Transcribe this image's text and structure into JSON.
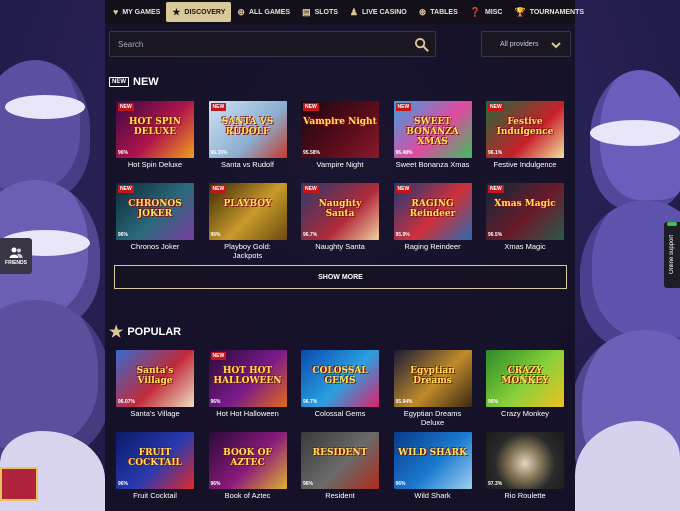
{
  "nav": {
    "items": [
      {
        "label": "MY GAMES",
        "icon": "heart-icon",
        "glyph": "♥",
        "active": false
      },
      {
        "label": "DISCOVERY",
        "icon": "star-icon",
        "glyph": "★",
        "active": true
      },
      {
        "label": "ALL GAMES",
        "icon": "globe-icon",
        "glyph": "⊕",
        "active": false
      },
      {
        "label": "SLOTS",
        "icon": "slots-icon",
        "glyph": "▤",
        "active": false
      },
      {
        "label": "LIVE CASINO",
        "icon": "dealer-icon",
        "glyph": "♟",
        "active": false
      },
      {
        "label": "TABLES",
        "icon": "chip-icon",
        "glyph": "⊛",
        "active": false
      },
      {
        "label": "MISC",
        "icon": "misc-icon",
        "glyph": "❓",
        "active": false
      },
      {
        "label": "TOURNAMENTS",
        "icon": "trophy-icon",
        "glyph": "🏆",
        "active": false
      }
    ]
  },
  "search": {
    "placeholder": "Search"
  },
  "providers": {
    "label": "All providers"
  },
  "sections": {
    "new": {
      "badge": "NEW",
      "title": "NEW",
      "games": [
        {
          "title": "Hot Spin Deluxe",
          "art": "HOT SPIN DELUXE",
          "rtp": "96%",
          "new": true,
          "bg": "linear-gradient(135deg,#3a0a45,#b0144a 55%,#f0a020)"
        },
        {
          "title": "Santa vs Rudolf",
          "art": "SANTA VS RUDOLF",
          "rtp": "96.35%",
          "new": true,
          "bg": "linear-gradient(135deg,#cfe3f5,#8aaed0 60%,#c43a2a)"
        },
        {
          "title": "Vampire Night",
          "art": "Vampire Night",
          "rtp": "95.58%",
          "new": true,
          "bg": "linear-gradient(135deg,#1a0810,#5a0c1a 60%,#8a1a2a)"
        },
        {
          "title": "Sweet Bonanza Xmas",
          "art": "SWEET BONANZA XMAS",
          "rtp": "96.48%",
          "new": true,
          "bg": "linear-gradient(135deg,#3aa0e0,#e04aa0 55%,#3cc060)"
        },
        {
          "title": "Festive Indulgence",
          "art": "Festive Indulgence",
          "rtp": "96.1%",
          "new": true,
          "bg": "linear-gradient(135deg,#1f6a3a,#c8202a 60%,#f3e0a0)"
        },
        {
          "title": "Chronos Joker",
          "art": "CHRONOS JOKER",
          "rtp": "96%",
          "new": true,
          "bg": "linear-gradient(135deg,#0e2a3a,#2a6a7a 55%,#7a3aa0)"
        },
        {
          "title": "Playboy Gold: Jackpots",
          "art": "PLAYBOY",
          "rtp": "96%",
          "new": true,
          "bg": "linear-gradient(135deg,#3a2808,#c89a2a 55%,#6a4a10)"
        },
        {
          "title": "Naughty Santa",
          "art": "Naughty Santa",
          "rtp": "96.7%",
          "new": true,
          "bg": "linear-gradient(135deg,#2a3a6a,#b02a3a 60%,#f0d0a0)"
        },
        {
          "title": "Raging Reindeer",
          "art": "RAGING Reindeer",
          "rtp": "95.9%",
          "new": true,
          "bg": "linear-gradient(135deg,#1a3a7a,#d0303a 55%,#2a6ab0)"
        },
        {
          "title": "Xmas Magic",
          "art": "Xmas Magic",
          "rtp": "96.5%",
          "new": true,
          "bg": "linear-gradient(135deg,#0a2a3a,#6a1a2a 55%,#2a5a4a)"
        }
      ]
    },
    "popular": {
      "title": "POPULAR",
      "games": [
        {
          "title": "Santa's Village",
          "art": "Santa's Village",
          "rtp": "96.07%",
          "new": false,
          "bg": "linear-gradient(135deg,#3a6ad0,#c02a3a 55%,#f0e0c0)"
        },
        {
          "title": "Hot Hot Halloween",
          "art": "HOT HOT HALLOWEEN",
          "rtp": "96%",
          "new": true,
          "bg": "linear-gradient(135deg,#2a0a3a,#7a1a8a 55%,#e06a1a)"
        },
        {
          "title": "Colossal Gems",
          "art": "COLOSSAL GEMS",
          "rtp": "96.7%",
          "new": false,
          "bg": "linear-gradient(135deg,#0a4ab0,#2aa0e0 55%,#e0206a)"
        },
        {
          "title": "Egyptian Dreams Deluxe",
          "art": "Egyptian Dreams",
          "rtp": "95.94%",
          "new": false,
          "bg": "linear-gradient(135deg,#1a1a3a,#c08a2a 55%,#3a2a10)"
        },
        {
          "title": "Crazy Monkey",
          "art": "CRAZY MONKEY",
          "rtp": "96%",
          "new": false,
          "bg": "linear-gradient(135deg,#2a8a2a,#8ad03a 55%,#f0c020)"
        },
        {
          "title": "Fruit Cocktail",
          "art": "FRUIT COCKTAIL",
          "rtp": "96%",
          "new": false,
          "bg": "linear-gradient(135deg,#0a1a6a,#2a3ab0 55%,#e02a2a)"
        },
        {
          "title": "Book of Aztec",
          "art": "BOOK OF AZTEC",
          "rtp": "96%",
          "new": false,
          "bg": "linear-gradient(135deg,#2a0a3a,#8a1a7a 55%,#e0b030)"
        },
        {
          "title": "Resident",
          "art": "RESIDENT",
          "rtp": "96%",
          "new": false,
          "bg": "linear-gradient(135deg,#3a3a3a,#6a6a6a 55%,#b02a1a)"
        },
        {
          "title": "Wild Shark",
          "art": "WILD SHARK",
          "rtp": "96%",
          "new": false,
          "bg": "linear-gradient(135deg,#0a3a8a,#1a7ad0 55%,#a0d0f0)"
        },
        {
          "title": "Rio Roulette",
          "art": "",
          "rtp": "97.3%",
          "new": false,
          "bg": "radial-gradient(circle at 50% 55%,#e0d8c0 0,#8a7a5a 30%,#2a2a2a 60%,#1a1a1a 100%)"
        }
      ]
    }
  },
  "show_more": {
    "label": "SHOW MORE"
  },
  "friends": {
    "label": "FRIENDS"
  },
  "support": {
    "label": "Online support"
  },
  "colors": {
    "accent": "#d8c89a",
    "new_badge": "#c2161b",
    "support_status": "#3fbf5a"
  }
}
